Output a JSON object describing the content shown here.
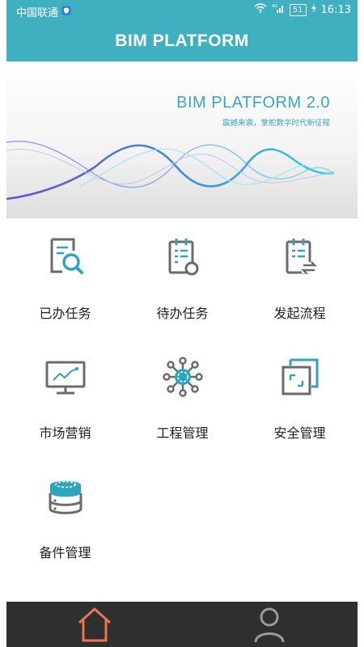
{
  "status_bar": {
    "carrier": "中国联通",
    "battery": "51",
    "time": "16:13"
  },
  "header": {
    "title": "BIM PLATFORM"
  },
  "banner": {
    "title": "BIM PLATFORM 2.0",
    "subtitle": "震撼来袭，掌舵数字时代新征程"
  },
  "menu": [
    {
      "label": "已办任务",
      "icon": "search-document-icon"
    },
    {
      "label": "待办任务",
      "icon": "pending-checklist-icon"
    },
    {
      "label": "发起流程",
      "icon": "process-exchange-icon"
    },
    {
      "label": "市场营销",
      "icon": "monitor-chart-icon"
    },
    {
      "label": "工程管理",
      "icon": "network-hub-icon"
    },
    {
      "label": "安全管理",
      "icon": "layered-squares-icon"
    },
    {
      "label": "备件管理",
      "icon": "database-icon"
    }
  ],
  "tabbar": {
    "tabs": [
      {
        "icon": "home-icon",
        "active": true
      },
      {
        "icon": "user-icon",
        "active": false
      }
    ]
  },
  "colors": {
    "accent": "#3eb0bf",
    "icon_gray": "#6b6b6b",
    "icon_teal": "#2ba6bd",
    "tab_active": "#e8764a",
    "tab_inactive": "#9a9a9a"
  }
}
